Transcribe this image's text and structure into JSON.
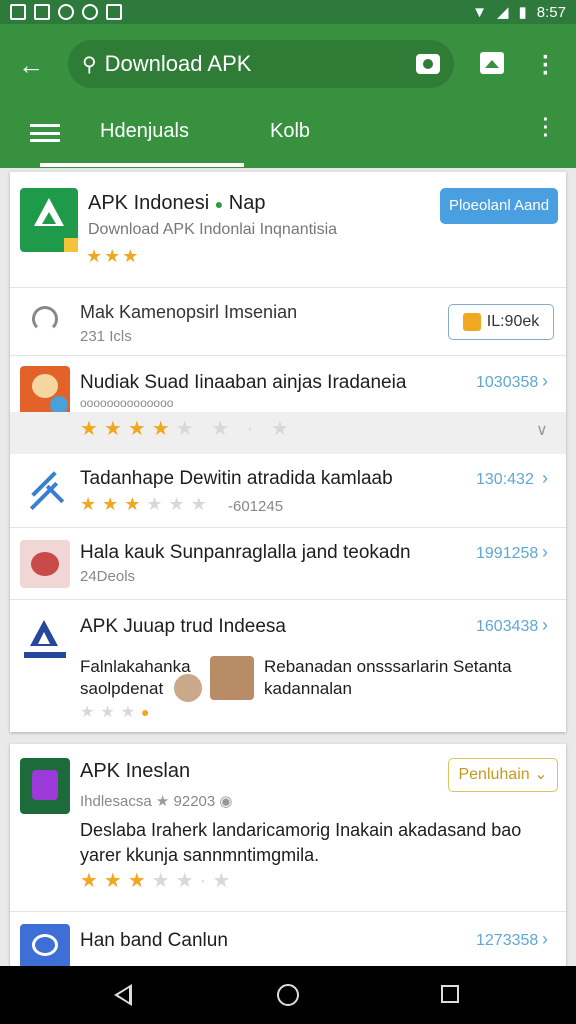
{
  "status_bar": {
    "time": "8:57"
  },
  "app_bar": {
    "search": {
      "query": "Download APK"
    },
    "tabs": [
      {
        "label": "Hdenjuals"
      },
      {
        "label": "Kolb"
      }
    ]
  },
  "results": {
    "featured": {
      "title": "APK Indonesi",
      "title_suffix": "Nap",
      "subtitle": "Download APK  Indonlai Inqnantisia",
      "rating": 3,
      "button_label": "Ploeolanl Aand",
      "colors": {
        "icon_bg": "#1e9a4a",
        "button": "#4a9fe0"
      }
    },
    "sponsored": {
      "title": "Mak  Kamenopsirl Imsenian",
      "meta": "231 Icls",
      "button_label": "IL:90ek"
    },
    "items": [
      {
        "title": "Nudiak Suad Iinaaban ainjas Iradaneia",
        "meta": "",
        "count": "1030358",
        "rating": 4
      },
      {
        "title": "Tadanhape Dewitin atradida kamlaab",
        "meta": "-601245",
        "count": "130:432",
        "rating": 3
      },
      {
        "title": "Hala kauk Sunpanraglalla jand teokadn",
        "meta": "24Deols",
        "count": "1991258",
        "rating": 0
      },
      {
        "title": "APK Juuap trud Indeesa",
        "count": "1603438",
        "review_left": [
          "Falnlakahanka",
          "saolpdenat"
        ],
        "review_right": [
          "Rebanadan onsssarlarin Setanta",
          "kadannalan"
        ]
      }
    ]
  },
  "second_card": {
    "app": {
      "title": "APK Ineslan",
      "meta": "Ihdlesacsa",
      "meta_count": "92203",
      "description": [
        "Deslaba Iraherk landaricamorig Inakain akadasand bao",
        "yarer kkunja sannmntimgmila."
      ],
      "button_label": "Penluhain",
      "rating": 3
    },
    "next": {
      "title": "Han band Canlun",
      "count": "1273358"
    }
  }
}
